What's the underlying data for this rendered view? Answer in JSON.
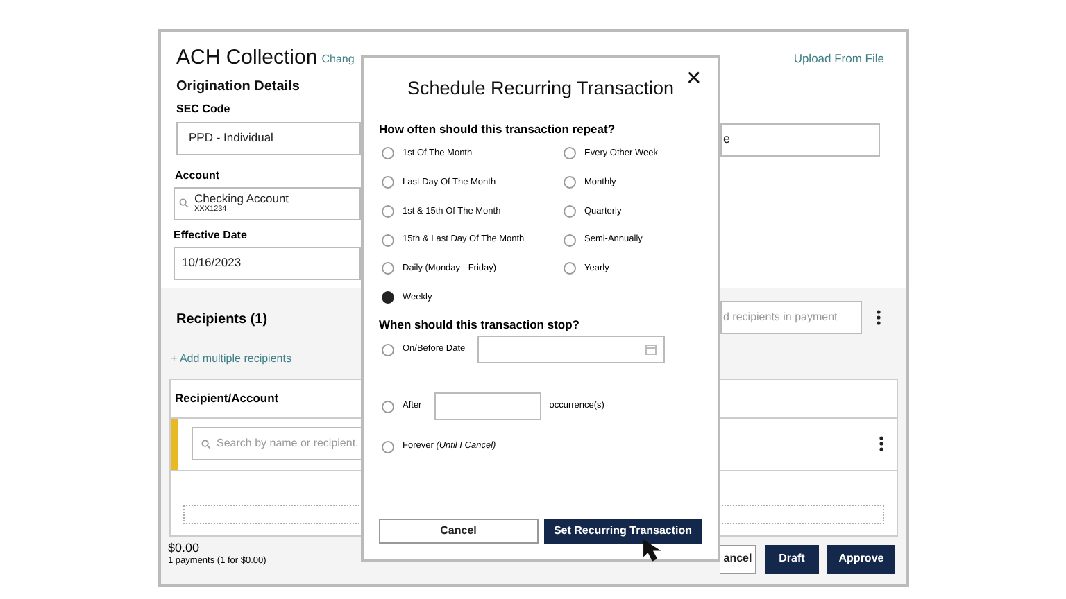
{
  "page": {
    "title": "ACH Collection",
    "change_link": "Chang",
    "upload_link": "Upload From File",
    "origination_heading": "Origination Details",
    "sec_code": {
      "label": "SEC Code",
      "value": "PPD - Individual"
    },
    "right_field": {
      "value": "e"
    },
    "account": {
      "label": "Account",
      "name": "Checking Account",
      "number": "XXX1234"
    },
    "effective_date": {
      "label": "Effective Date",
      "value": "10/16/2023"
    },
    "recipients": {
      "heading": "Recipients (1)",
      "search_placeholder": "d recipients in payment",
      "add_link": "+ Add multiple recipients",
      "column_1": "Recipient/Account",
      "row_search_placeholder": "Search by name or recipient."
    },
    "total": "$0.00",
    "summary": "1 payments (1 for $0.00)",
    "buttons": [
      {
        "kind": "outline",
        "label": "ancel"
      },
      {
        "kind": "primary",
        "label": "Draft"
      },
      {
        "kind": "primary",
        "label": "Approve"
      }
    ]
  },
  "dialog": {
    "title": "Schedule Recurring Transaction",
    "close": "✕",
    "repeat_question": "How often should this transaction repeat?",
    "frequency_options": [
      {
        "label": "1st Of The Month",
        "selected": false
      },
      {
        "label": "Every Other Week",
        "selected": false
      },
      {
        "label": "Last Day Of The Month",
        "selected": false
      },
      {
        "label": "Monthly",
        "selected": false
      },
      {
        "label": "1st & 15th Of The Month",
        "selected": false
      },
      {
        "label": "Quarterly",
        "selected": false
      },
      {
        "label": "15th & Last Day Of The Month",
        "selected": false
      },
      {
        "label": "Semi-Annually",
        "selected": false
      },
      {
        "label": "Daily (Monday - Friday)",
        "selected": false
      },
      {
        "label": "Yearly",
        "selected": false
      },
      {
        "label": "Weekly",
        "selected": true
      }
    ],
    "stop_question": "When should this transaction stop?",
    "stop_options": [
      {
        "kind": "date",
        "label": "On/Before Date",
        "selected": false
      },
      {
        "kind": "count",
        "label": "After",
        "suffix": "occurrence(s)",
        "selected": false
      },
      {
        "kind": "none",
        "label": "Forever *(Until I Cancel)*",
        "selected": false
      }
    ],
    "buttons": [
      {
        "kind": "outline",
        "label": "Cancel"
      },
      {
        "kind": "primary",
        "label": "Set Recurring Transaction"
      }
    ]
  }
}
